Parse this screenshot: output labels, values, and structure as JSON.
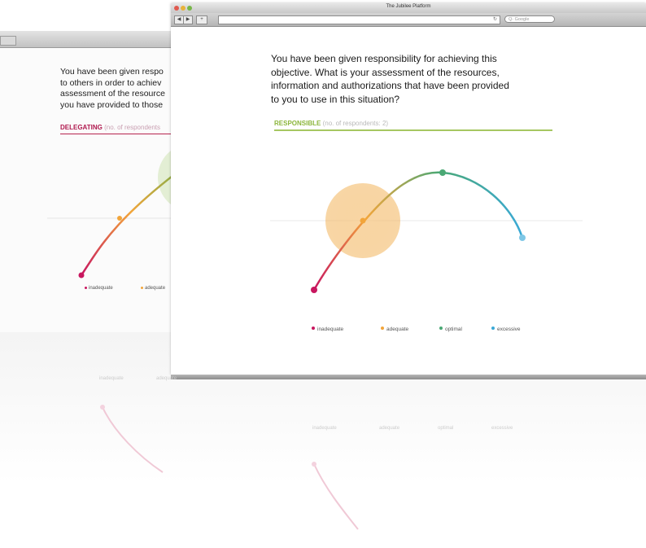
{
  "main_window": {
    "title": "The Jubilee Platform",
    "search_placeholder": "Q- Google",
    "question": "You have been given responsibility for achieving this\nobjective. What is your assessment of the resources,\ninformation and authorizations that have been provided\nto you to use in this situation?",
    "category": "RESPONSIBLE",
    "respondents": "(no. of respondents: 2)",
    "legend": [
      {
        "label": "inadequate",
        "color": "#c8175f"
      },
      {
        "label": "adequate",
        "color": "#f2a53a"
      },
      {
        "label": "optimal",
        "color": "#4aa874"
      },
      {
        "label": "excessive",
        "color": "#3aa9d6"
      }
    ]
  },
  "back_window": {
    "question": "You have been given respo\nto others in order to achiev\nassessment of the resource\nyou have provided to those",
    "category": "DELEGATING",
    "respondents": "(no. of respondents",
    "legend": [
      {
        "label": "inadequate",
        "color": "#c8175f"
      },
      {
        "label": "adequate",
        "color": "#f2a53a"
      }
    ]
  },
  "reflections": {
    "back_legend": [
      "inadequate",
      "adequate"
    ],
    "main_legend": [
      "inadequate",
      "adequate",
      "optimal",
      "excessive"
    ]
  },
  "colors": {
    "responsible_accent": "#8cb63c",
    "delegating_accent": "#b0184e"
  }
}
